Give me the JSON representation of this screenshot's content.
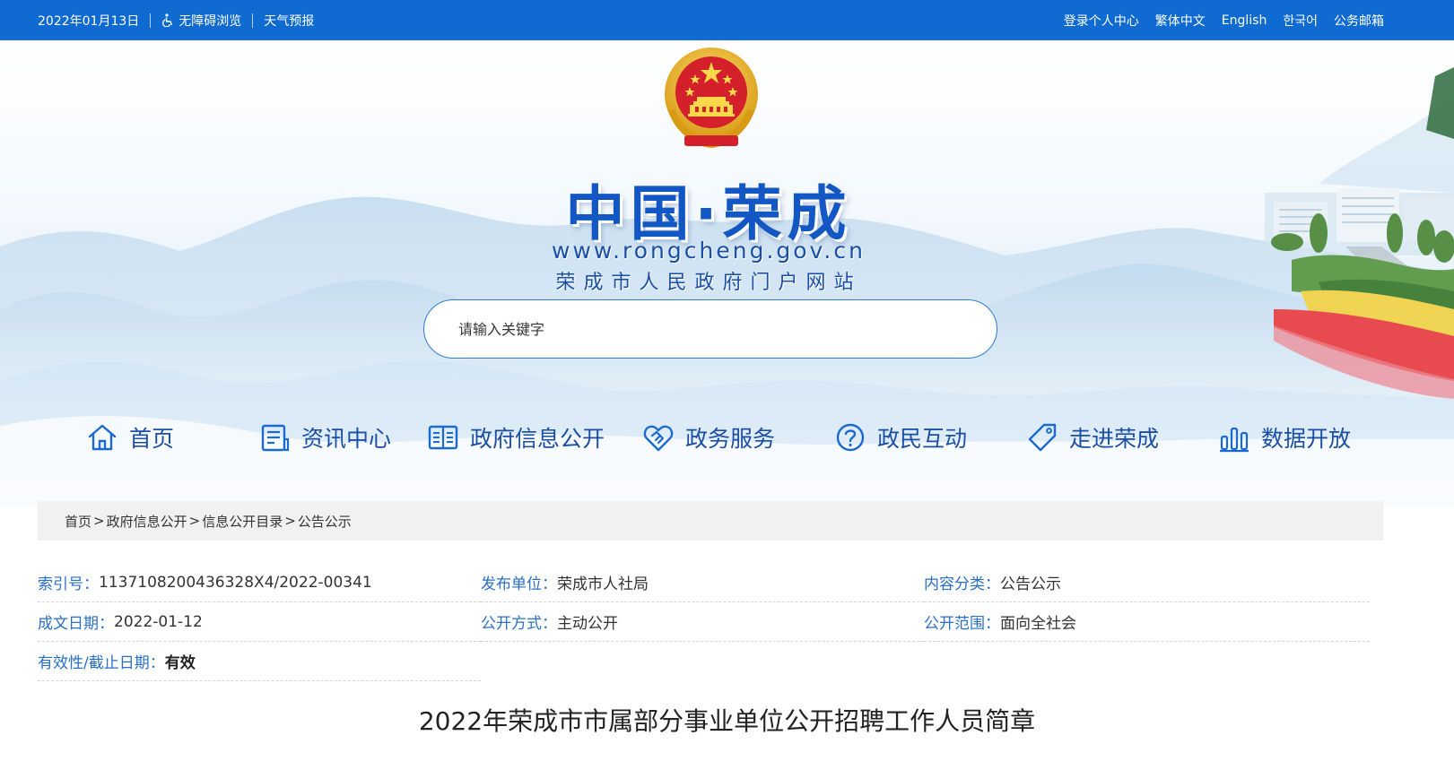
{
  "topbar": {
    "date": "2022年01月13日",
    "accessibility": "无障碍浏览",
    "weather": "天气预报",
    "links": [
      "登录个人中心",
      "繁体中文",
      "English",
      "한국어",
      "公务邮箱"
    ]
  },
  "logo": {
    "title": "中国·荣成",
    "url": "www.rongcheng.gov.cn",
    "subtitle": "荣成市人民政府门户网站"
  },
  "search": {
    "placeholder": "请输入关键字"
  },
  "nav": {
    "items": [
      {
        "label": "首页",
        "icon": "home-icon"
      },
      {
        "label": "资讯中心",
        "icon": "document-icon"
      },
      {
        "label": "政府信息公开",
        "icon": "book-icon"
      },
      {
        "label": "政务服务",
        "icon": "handshake-icon"
      },
      {
        "label": "政民互动",
        "icon": "question-icon"
      },
      {
        "label": "走进荣成",
        "icon": "tag-icon"
      },
      {
        "label": "数据开放",
        "icon": "bar-chart-icon"
      }
    ]
  },
  "breadcrumb": {
    "items": [
      "首页",
      "政府信息公开",
      "信息公开目录",
      "公告公示"
    ],
    "separator": ">"
  },
  "meta": {
    "index_label": "索引号：",
    "index_value": "1137108200436328X4/2022-00341",
    "publisher_label": "发布单位：",
    "publisher_value": "荣成市人社局",
    "category_label": "内容分类：",
    "category_value": "公告公示",
    "date_label": "成文日期：",
    "date_value": "2022-01-12",
    "method_label": "公开方式：",
    "method_value": "主动公开",
    "scope_label": "公开范围：",
    "scope_value": "面向全社会",
    "validity_label": "有效性/截止日期：",
    "validity_value": "有效"
  },
  "article": {
    "title": "2022年荣成市市属部分事业单位公开招聘工作人员简章"
  },
  "colors": {
    "topbar": "#0f6ad1",
    "brand_blue": "#1357c4",
    "nav_text": "#1b4fa5",
    "meta_key": "#2a6fc7"
  }
}
